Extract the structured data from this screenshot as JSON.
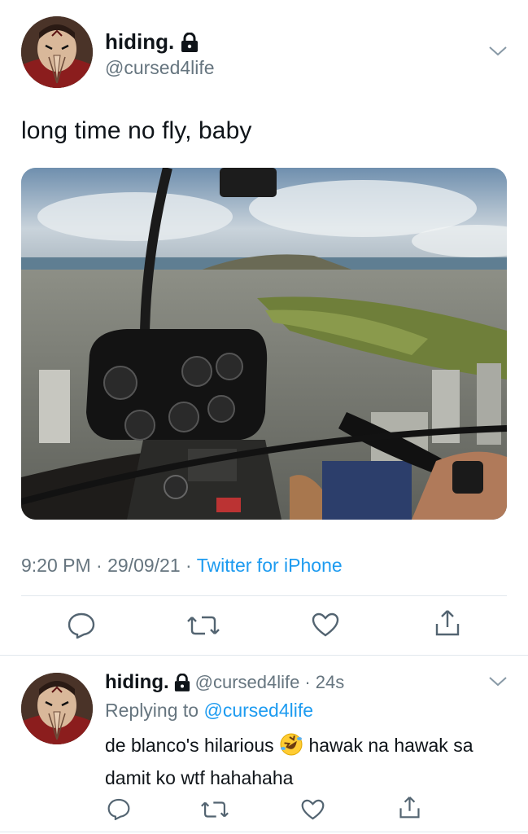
{
  "tweet": {
    "display_name": "hiding.",
    "handle": "@cursed4life",
    "text": "long time no fly, baby",
    "time": "9:20 PM",
    "date": "29/09/21",
    "source": "Twitter for iPhone",
    "separator": "·"
  },
  "reply": {
    "display_name": "hiding.",
    "handle": "@cursed4life",
    "time": "24s",
    "replying_prefix": "Replying to",
    "replying_to": "@cursed4life",
    "text_part1": "de blanco's hilarious",
    "emoji": "rolling-on-floor-laughing",
    "text_part2": "hawak na hawak sa damit ko wtf hahahaha"
  },
  "icons": {
    "lock": "lock-icon",
    "chevron": "chevron-down-icon",
    "reply": "reply-icon",
    "retweet": "retweet-icon",
    "like": "heart-icon",
    "share": "share-icon"
  },
  "colors": {
    "link": "#1d9bf0",
    "secondary_text": "#66757f",
    "divider": "#e1e8ed"
  }
}
